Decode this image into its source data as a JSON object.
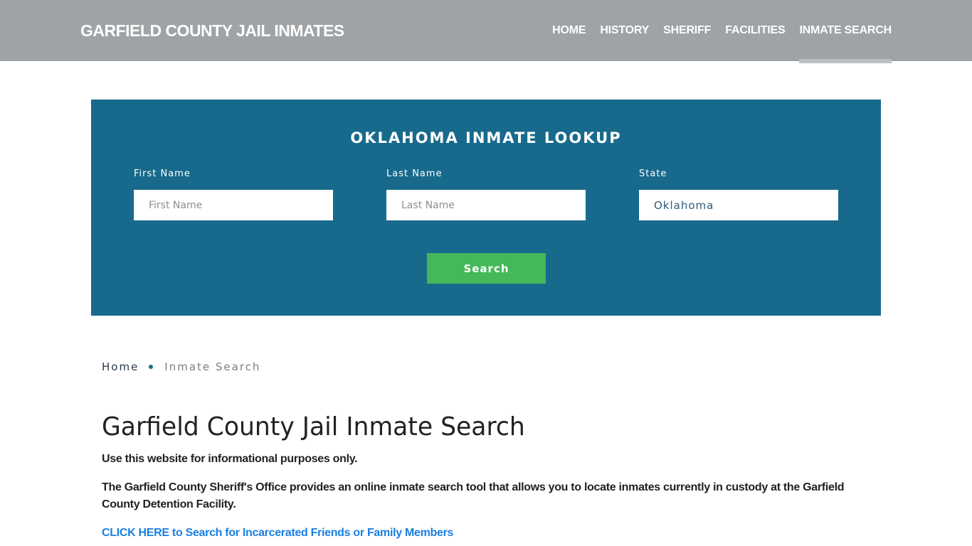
{
  "header": {
    "brand": "GARFIELD COUNTY JAIL INMATES",
    "nav": [
      {
        "label": "HOME",
        "active": false
      },
      {
        "label": "HISTORY",
        "active": false
      },
      {
        "label": "SHERIFF",
        "active": false
      },
      {
        "label": "FACILITIES",
        "active": false
      },
      {
        "label": "INMATE SEARCH",
        "active": true
      }
    ]
  },
  "lookup": {
    "title": "OKLAHOMA INMATE LOOKUP",
    "first_name": {
      "label": "First Name",
      "placeholder": "First Name",
      "value": ""
    },
    "last_name": {
      "label": "Last Name",
      "placeholder": "Last Name",
      "value": ""
    },
    "state": {
      "label": "State",
      "value": "Oklahoma"
    },
    "search_label": "Search"
  },
  "breadcrumb": {
    "home": "Home",
    "current": "Inmate Search"
  },
  "content": {
    "title": "Garfield County Jail Inmate Search",
    "disclaimer": "Use this website for informational purposes only.",
    "description": "The Garfield County Sheriff's Office provides an online inmate search tool that allows you to locate inmates currently in custody at the Garfield County Detention Facility.",
    "cta": "CLICK HERE to Search for Incarcerated Friends or Family Members"
  },
  "colors": {
    "header_bg": "#9fa3a6",
    "panel_bg": "#176a8c",
    "button_bg": "#44b85a",
    "link": "#1a7fe0"
  }
}
